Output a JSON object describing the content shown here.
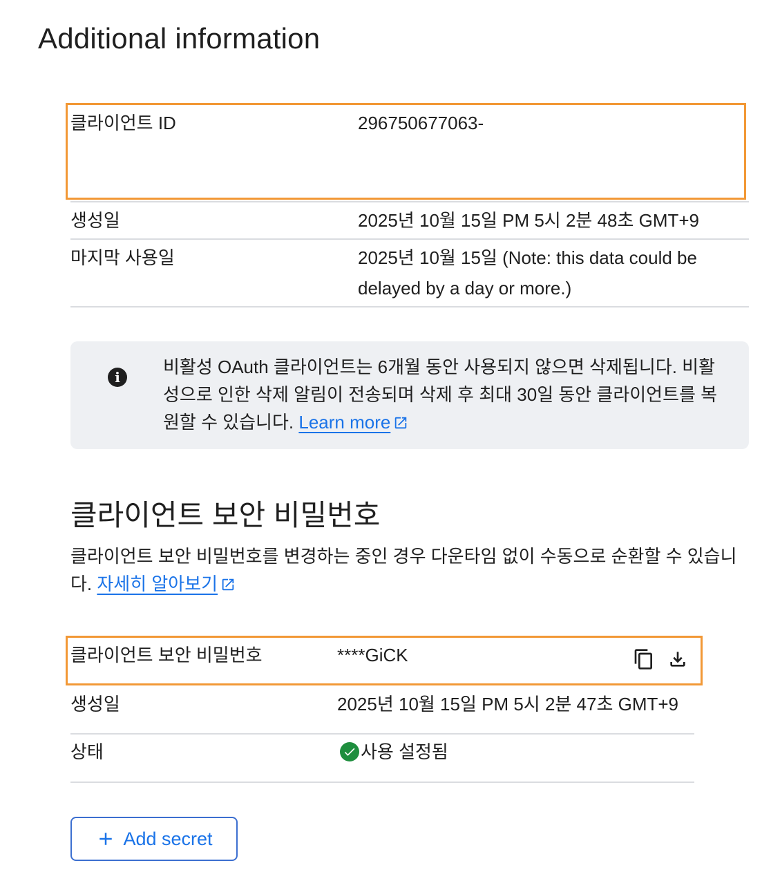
{
  "page": {
    "title": "Additional information"
  },
  "client": {
    "id_label": "클라이언트 ID",
    "id_value": "296750677063-",
    "created_label": "생성일",
    "created_value": "2025년 10월 15일 PM 5시 2분 48초 GMT+9",
    "last_used_label": "마지막 사용일",
    "last_used_value_line1": "2025년 10월 15일 (Note: this data could be",
    "last_used_value_line2": "delayed by a day or more.)"
  },
  "notice": {
    "icon": "info-icon",
    "text": "비활성 OAuth 클라이언트는 6개월 동안 사용되지 않으면 삭제됩니다. 비활성으로 인한 삭제 알림이 전송되며 삭제 후 최대 30일 동안 클라이언트를 복원할 수 있습니다.",
    "link_label": "Learn more"
  },
  "secrets": {
    "heading": "클라이언트 보안 비밀번호",
    "description": "클라이언트 보안 비밀번호를 변경하는 중인 경우 다운타임 없이 수동으로 순환할 수 있습니다.",
    "link_label": "자세히 알아보기",
    "secret_label": "클라이언트 보안 비밀번호",
    "secret_value": "****GiCK",
    "created_label": "생성일",
    "created_value": "2025년 10월 15일 PM 5시 2분 47초 GMT+9",
    "status_label": "상태",
    "status_value": "사용 설정됨",
    "add_button_label": "Add secret"
  },
  "colors": {
    "highlight": "#f29836",
    "link": "#1a73e8",
    "status_ok": "#1e8e3e",
    "notice_bg": "#eef0f3"
  }
}
